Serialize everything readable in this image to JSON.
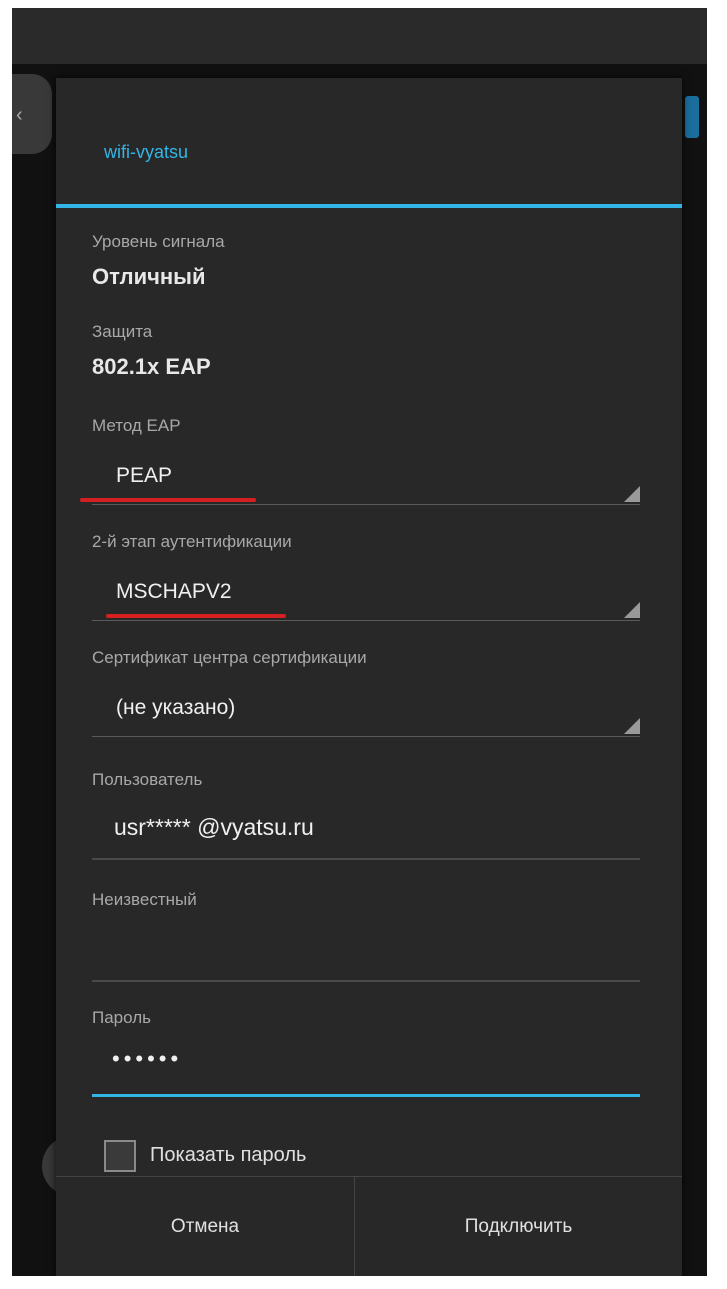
{
  "dialog": {
    "title": "wifi-vyatsu",
    "signal_label": "Уровень сигнала",
    "signal_value": "Отличный",
    "security_label": "Защита",
    "security_value": "802.1x EAP",
    "eap_method_label": "Метод EAP",
    "eap_method_value": "PEAP",
    "phase2_label": "2-й этап аутентификации",
    "phase2_value": "MSCHAPV2",
    "ca_cert_label": "Сертификат центра сертификации",
    "ca_cert_value": "(не указано)",
    "identity_label": "Пользователь",
    "identity_value": "usr***** @vyatsu.ru",
    "anonymous_label": "Неизвестный",
    "anonymous_value": "",
    "password_label": "Пароль",
    "password_value": "••••••",
    "show_password_label": "Показать пароль",
    "cancel_label": "Отмена",
    "connect_label": "Подключить"
  },
  "colors": {
    "accent": "#33b5e5",
    "highlight_underline": "#d42020",
    "dialog_background": "#282828"
  },
  "icons": {
    "spinner_arrow": "triangle-corner-icon",
    "back": "chevron-left-icon"
  }
}
